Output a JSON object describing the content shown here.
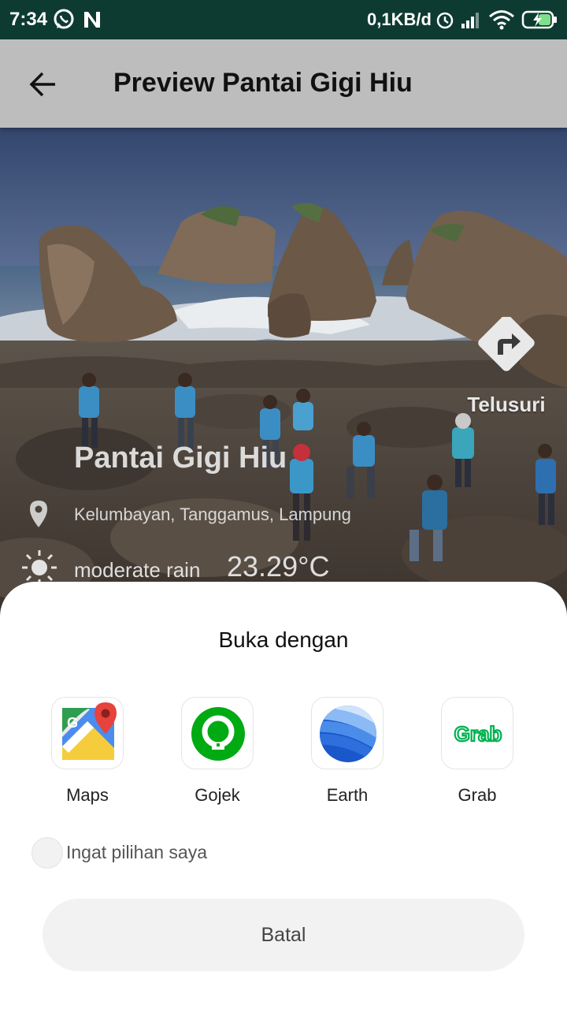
{
  "status_bar": {
    "time": "7:34",
    "data_rate": "0,1KB/d"
  },
  "toolbar": {
    "title": "Preview Pantai Gigi Hiu"
  },
  "hero": {
    "place_name": "Pantai Gigi Hiu",
    "location": "Kelumbayan, Tanggamus, Lampung",
    "weather_description": "moderate rain",
    "temperature": "23.29°C",
    "explore_label": "Telusuri"
  },
  "sheet": {
    "title": "Buka dengan",
    "apps": [
      {
        "label": "Maps",
        "icon": "google-maps-icon"
      },
      {
        "label": "Gojek",
        "icon": "gojek-icon"
      },
      {
        "label": "Earth",
        "icon": "google-earth-icon"
      },
      {
        "label": "Grab",
        "icon": "grab-icon",
        "icon_text": "Grab"
      }
    ],
    "remember_label": "Ingat pilihan saya",
    "remember_checked": false,
    "cancel_label": "Batal"
  },
  "colors": {
    "status_bar_bg": "#0e3b31",
    "toolbar_bg": "#bdbdbd",
    "gojek_green": "#00aa13",
    "grab_green": "#00b14f",
    "sheet_button_bg": "#f2f2f2"
  }
}
